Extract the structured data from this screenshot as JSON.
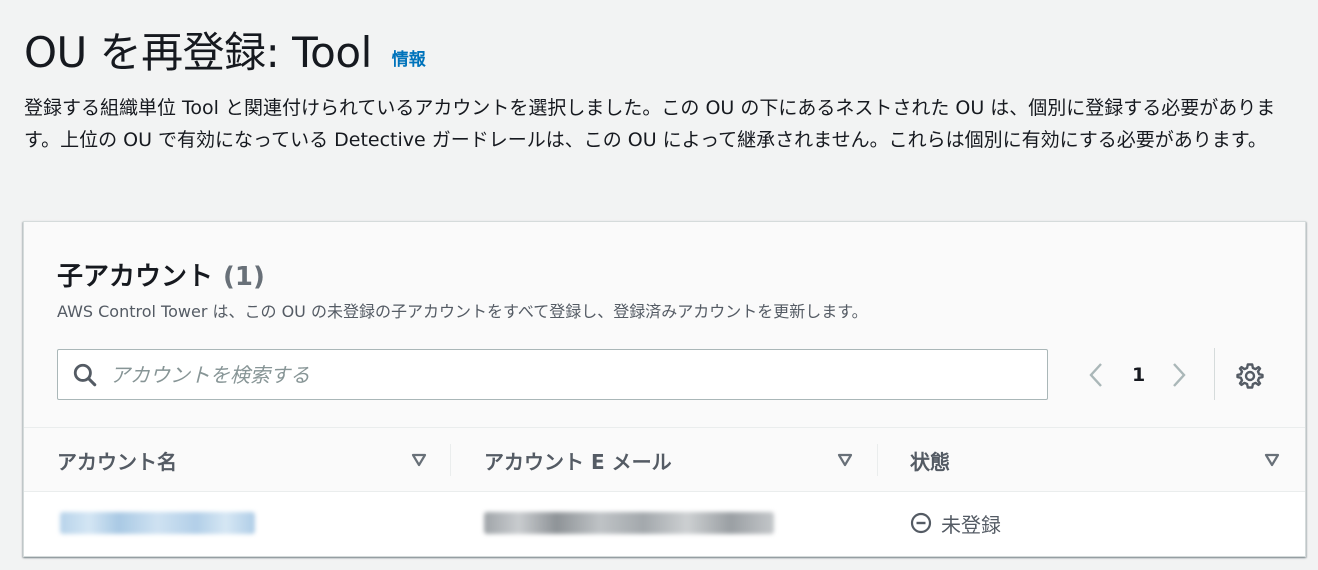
{
  "header": {
    "title": "OU を再登録: Tool",
    "info_label": "情報",
    "description": "登録する組織単位 Tool と関連付けられているアカウントを選択しました。この OU の下にあるネストされた OU は、個別に登録する必要があります。上位の OU で有効になっている Detective ガードレールは、この OU によって継承されません。これらは個別に有効にする必要があります。"
  },
  "panel": {
    "title": "子アカウント",
    "count": "(1)",
    "description": "AWS Control Tower は、この OU の未登録の子アカウントをすべて登録し、登録済みアカウントを更新します。",
    "search": {
      "placeholder": "アカウントを検索する",
      "value": ""
    },
    "pagination": {
      "current_page": "1"
    },
    "table": {
      "columns": [
        {
          "label": "アカウント名"
        },
        {
          "label": "アカウント E メール"
        },
        {
          "label": "状態"
        }
      ],
      "rows": [
        {
          "status": "未登録"
        }
      ]
    }
  },
  "colors": {
    "link": "#0073bb",
    "background": "#f2f3f3",
    "status_neutral": "#545b64"
  },
  "icons": {
    "search": "search-icon",
    "prev": "chevron-left-icon",
    "next": "chevron-right-icon",
    "settings": "gear-icon",
    "sort": "caret-down-icon",
    "status": "stopped-icon"
  }
}
